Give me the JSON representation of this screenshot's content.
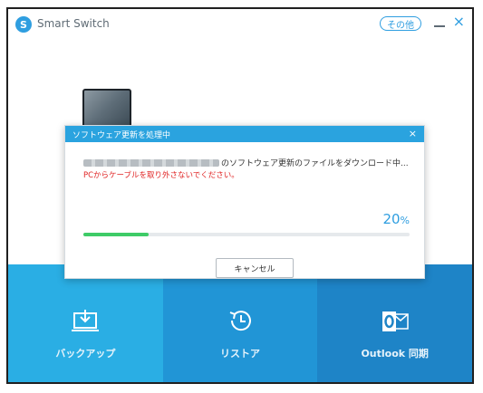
{
  "app": {
    "logo_letter": "S",
    "title": "Smart Switch",
    "more_button": "その他",
    "minimize": "_",
    "close": "×"
  },
  "modal": {
    "title": "ソフトウェア更新を処理中",
    "close": "×",
    "download_message": "のソフトウェア更新のファイルをダウンロード中...",
    "warning": "PCからケーブルを取り外さないでください。",
    "progress_percent": 20,
    "progress_value": "20",
    "progress_unit": "%",
    "cancel_label": "キャンセル"
  },
  "tiles": [
    {
      "label": "バックアップ",
      "icon": "backup-icon"
    },
    {
      "label": "リストア",
      "icon": "restore-icon"
    },
    {
      "label": "Outlook 同期",
      "icon": "outlook-icon"
    }
  ],
  "colors": {
    "accent": "#2f9ee0",
    "tile_backup": "#2aaee4",
    "tile_restore": "#2195d6",
    "tile_outlook": "#1e84c7",
    "progress": "#3ecb67",
    "warning": "#e02424"
  }
}
